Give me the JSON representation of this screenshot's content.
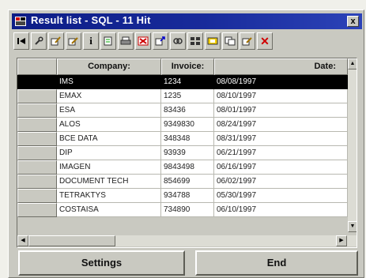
{
  "window": {
    "title": "Result list - SQL - 11 Hit",
    "close_label": "x"
  },
  "toolbar": {
    "buttons": [
      {
        "name": "first-record-icon"
      },
      {
        "name": "wrench-icon"
      },
      {
        "name": "edit-icon"
      },
      {
        "name": "edit-alt-icon"
      },
      {
        "name": "info-icon",
        "label": "i"
      },
      {
        "name": "refresh-icon"
      },
      {
        "name": "print-icon"
      },
      {
        "name": "delete-red-icon"
      },
      {
        "name": "export-icon"
      },
      {
        "name": "link-icon"
      },
      {
        "name": "grid-icon"
      },
      {
        "name": "highlight-icon"
      },
      {
        "name": "copy-icon"
      },
      {
        "name": "paste-icon"
      },
      {
        "name": "close-red-icon",
        "label": "✕"
      }
    ]
  },
  "table": {
    "columns": [
      "Company:",
      "Invoice:",
      "Date:"
    ],
    "rows": [
      {
        "company": "IMS",
        "invoice": "1234",
        "date": "08/08/1997",
        "selected": true
      },
      {
        "company": "EMAX",
        "invoice": "1235",
        "date": "08/10/1997"
      },
      {
        "company": "ESA",
        "invoice": "83436",
        "date": "08/01/1997"
      },
      {
        "company": "ALOS",
        "invoice": "9349830",
        "date": "08/24/1997"
      },
      {
        "company": "BCE DATA",
        "invoice": "348348",
        "date": "08/31/1997"
      },
      {
        "company": "DIP",
        "invoice": "93939",
        "date": "06/21/1997"
      },
      {
        "company": "IMAGEN",
        "invoice": "9843498",
        "date": "06/16/1997"
      },
      {
        "company": "DOCUMENT TECH",
        "invoice": "854699",
        "date": "06/02/1997"
      },
      {
        "company": "TETRAKTYS",
        "invoice": "934788",
        "date": "05/30/1997"
      },
      {
        "company": "COSTAISA",
        "invoice": "734890",
        "date": "06/10/1997"
      }
    ]
  },
  "buttons": {
    "settings": "Settings",
    "end": "End"
  },
  "colors": {
    "selected_row": "#000000",
    "title_bar": "#0c1c86",
    "window": "#c9c9c1"
  }
}
